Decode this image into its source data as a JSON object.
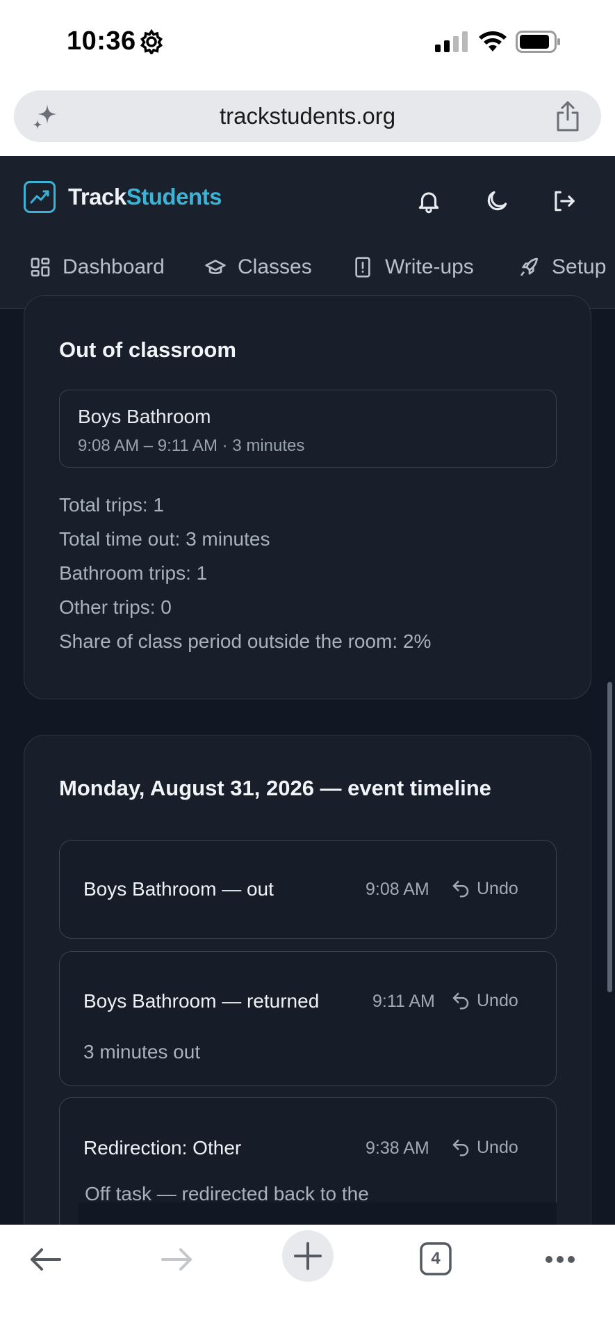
{
  "status_bar": {
    "time": "10:36"
  },
  "browser": {
    "url": "trackstudents.org",
    "tab_count": "4"
  },
  "app": {
    "brand_primary": "Track",
    "brand_accent": "Students",
    "accent_color": "#3bb3d6",
    "nav": [
      {
        "label": "Dashboard",
        "icon": "dashboard-icon"
      },
      {
        "label": "Classes",
        "icon": "graduation-cap-icon"
      },
      {
        "label": "Write-ups",
        "icon": "alert-document-icon"
      },
      {
        "label": "Setup",
        "icon": "rocket-icon"
      }
    ]
  },
  "out_of_classroom": {
    "title": "Out of classroom",
    "trip": {
      "name": "Boys Bathroom",
      "time": "9:08 AM – 9:11 AM · 3 minutes"
    },
    "stats": [
      "Total trips: 1",
      "Total time out: 3 minutes",
      "Bathroom trips: 1",
      "Other trips: 0",
      "Share of class period outside the room: 2%"
    ]
  },
  "timeline": {
    "title": "Monday, August 31, 2026 — event timeline",
    "undo_label": "Undo",
    "events": [
      {
        "title": "Boys Bathroom — out",
        "time": "9:08 AM",
        "note": ""
      },
      {
        "title": "Boys Bathroom — returned",
        "time": "9:11 AM",
        "note": "3 minutes out"
      },
      {
        "title": "Redirection: Other",
        "time": "9:38 AM",
        "note": "Off task — redirected back to the"
      }
    ]
  }
}
